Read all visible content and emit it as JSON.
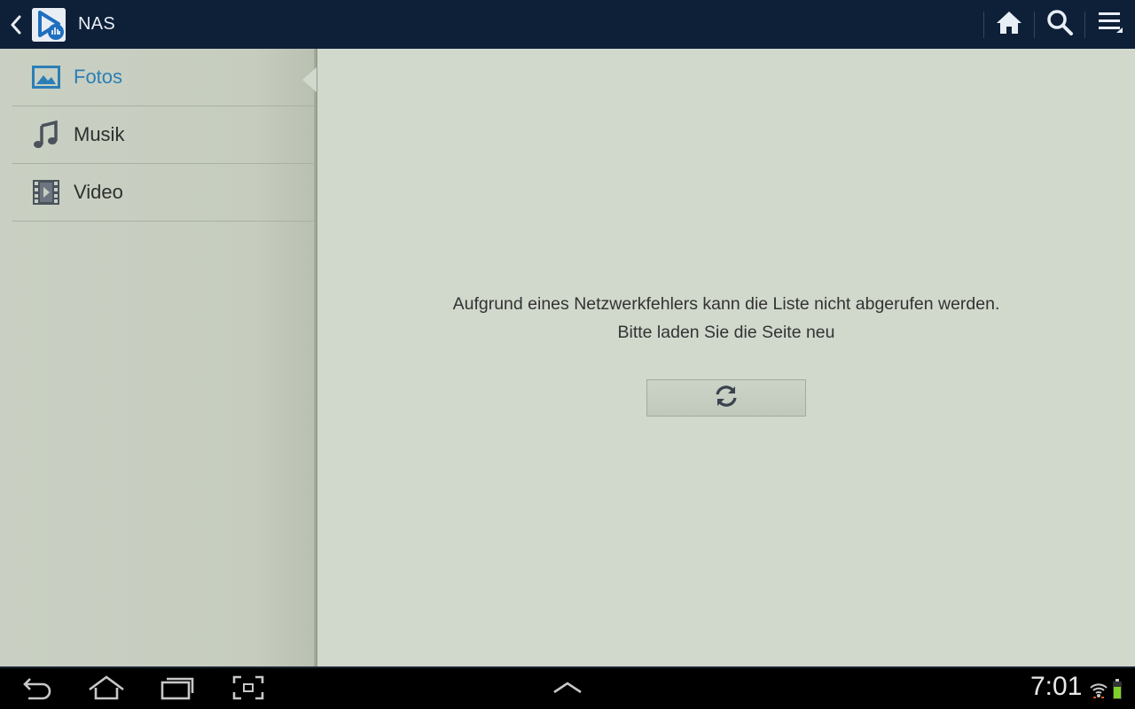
{
  "app": {
    "title": "NAS",
    "logo_icon": "media-player-logo-icon",
    "accent_color": "#2b7fb6"
  },
  "actionbar": {
    "background": "#0e1f38",
    "actions": [
      "home-icon",
      "search-icon",
      "menu-list-icon"
    ]
  },
  "sidebar": {
    "items": [
      {
        "label": "Fotos",
        "icon": "image-icon",
        "selected": true
      },
      {
        "label": "Musik",
        "icon": "music-note-icon",
        "selected": false
      },
      {
        "label": "Video",
        "icon": "film-icon",
        "selected": false
      }
    ]
  },
  "main": {
    "error_line1": "Aufgrund eines Netzwerkfehlers kann die Liste nicht abgerufen werden.",
    "error_line2": "Bitte laden Sie die Seite neu",
    "refresh_icon": "refresh-icon"
  },
  "statusbar": {
    "time": "7:01",
    "nav_buttons": [
      "back-icon",
      "home-icon",
      "recent-apps-icon",
      "screenshot-icon",
      "up-chevron-icon"
    ],
    "status_icons": [
      "wifi-icon",
      "battery-icon"
    ]
  }
}
